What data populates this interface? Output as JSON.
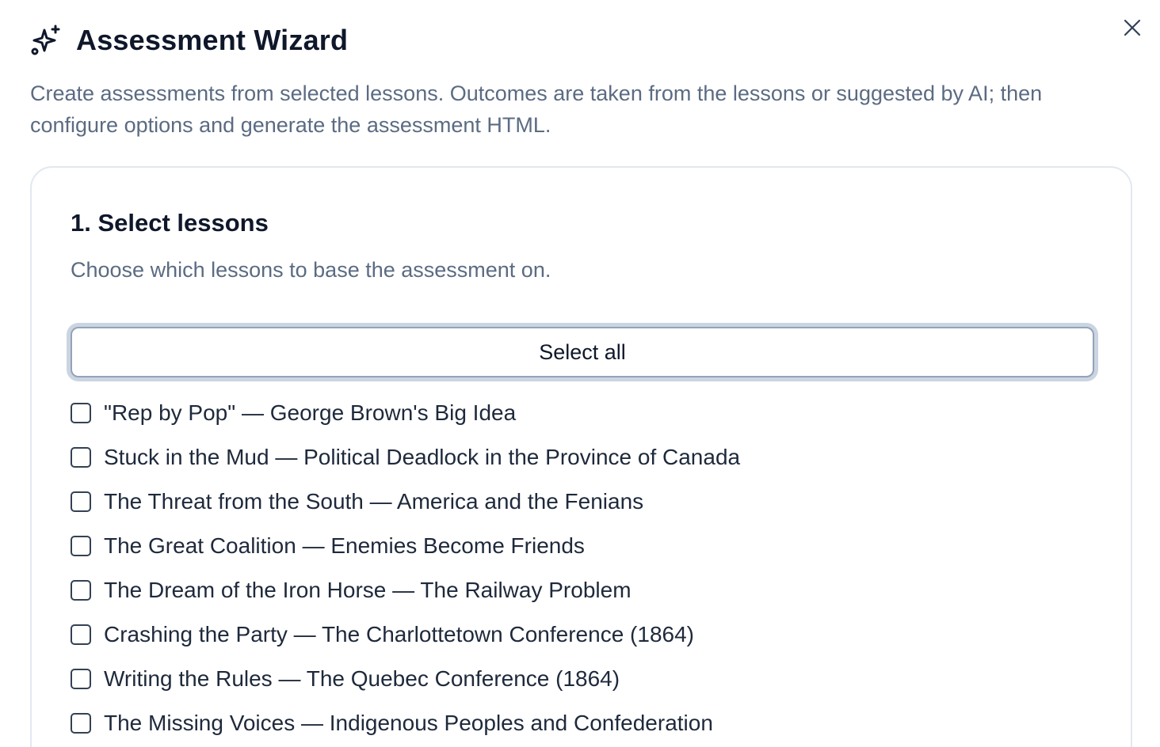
{
  "dialog": {
    "title": "Assessment Wizard",
    "description": "Create assessments from selected lessons. Outcomes are taken from the lessons or suggested by AI; then configure options and generate the assessment HTML.",
    "title_icon": "sparkles-icon",
    "close_icon": "close-icon"
  },
  "step1": {
    "title": "1. Select lessons",
    "description": "Choose which lessons to base the assessment on.",
    "select_all_label": "Select all",
    "lessons": [
      {
        "label": "\"Rep by Pop\" — George Brown's Big Idea",
        "checked": false
      },
      {
        "label": "Stuck in the Mud — Political Deadlock in the Province of Canada",
        "checked": false
      },
      {
        "label": "The Threat from the South — America and the Fenians",
        "checked": false
      },
      {
        "label": "The Great Coalition — Enemies Become Friends",
        "checked": false
      },
      {
        "label": "The Dream of the Iron Horse — The Railway Problem",
        "checked": false
      },
      {
        "label": "Crashing the Party — The Charlottetown Conference (1864)",
        "checked": false
      },
      {
        "label": "Writing the Rules — The Quebec Conference (1864)",
        "checked": false
      },
      {
        "label": "The Missing Voices — Indigenous Peoples and Confederation",
        "checked": false
      }
    ]
  },
  "colors": {
    "text_primary": "#0f172a",
    "text_muted": "#5b6b82",
    "card_border": "#e2e8f0",
    "button_border": "#94a3b8"
  }
}
